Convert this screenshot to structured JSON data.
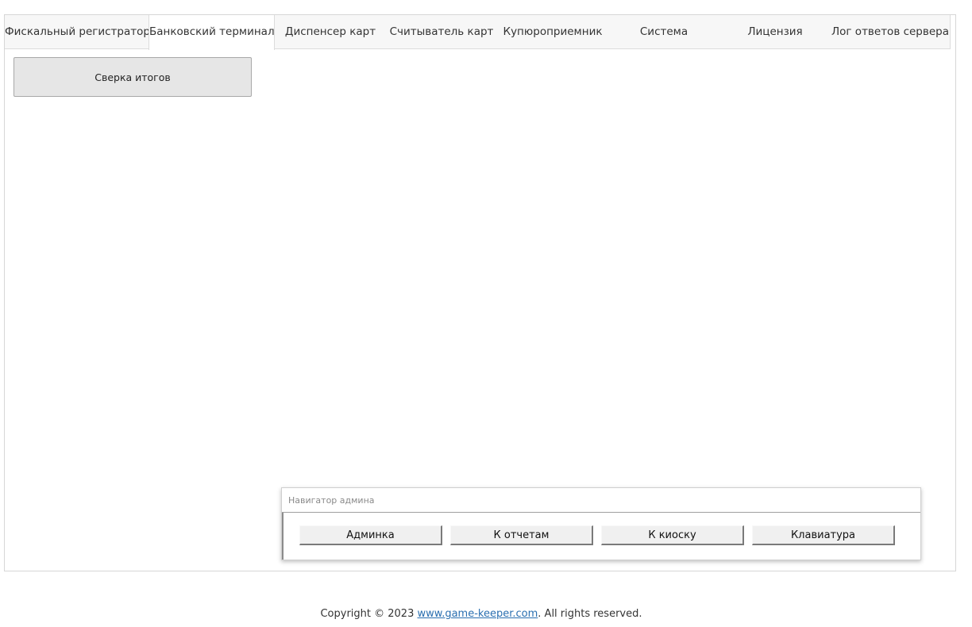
{
  "tabs": [
    {
      "label": "Фискальный регистратор"
    },
    {
      "label": "Банковский терминал"
    },
    {
      "label": "Диспенсер карт"
    },
    {
      "label": "Считыватель карт"
    },
    {
      "label": "Купюроприемник"
    },
    {
      "label": "Система"
    },
    {
      "label": "Лицензия"
    },
    {
      "label": "Лог ответов сервера"
    }
  ],
  "active_tab": "Банковский терминал",
  "content": {
    "reconciliation_button": "Сверка итогов"
  },
  "navigator": {
    "title": "Навигатор админа",
    "buttons": [
      {
        "label": "Админка"
      },
      {
        "label": "К отчетам"
      },
      {
        "label": "К киоску"
      },
      {
        "label": "Клавиатура"
      }
    ]
  },
  "footer": {
    "prefix": "Copyright © 2023 ",
    "link_text": "www.game-keeper.com",
    "suffix": ". All rights reserved."
  }
}
